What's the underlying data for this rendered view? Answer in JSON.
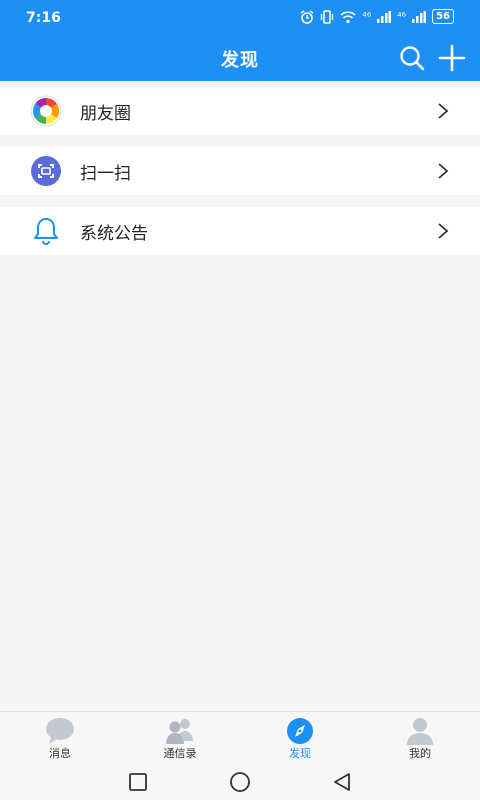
{
  "status_bar": {
    "time": "7:16",
    "signal_1": "⁴⁶",
    "signal_2": "⁴⁶",
    "battery": "56"
  },
  "header": {
    "title": "发现"
  },
  "menu": {
    "items": [
      {
        "label": "朋友圈"
      },
      {
        "label": "扫一扫"
      },
      {
        "label": "系统公告"
      }
    ]
  },
  "tabs": [
    {
      "label": "消息"
    },
    {
      "label": "通信录"
    },
    {
      "label": "发现",
      "active": true
    },
    {
      "label": "我的"
    }
  ],
  "colors": {
    "primary": "#1e90f5",
    "scan_icon_bg": "#5a6bdc",
    "inactive_icon": "#c4c8d0"
  },
  "icons": {
    "search": "search-icon",
    "add": "plus-icon",
    "moments": "aperture-icon",
    "scan": "scan-icon",
    "announcement": "bell-icon",
    "chevron": "chevron-right-icon"
  }
}
